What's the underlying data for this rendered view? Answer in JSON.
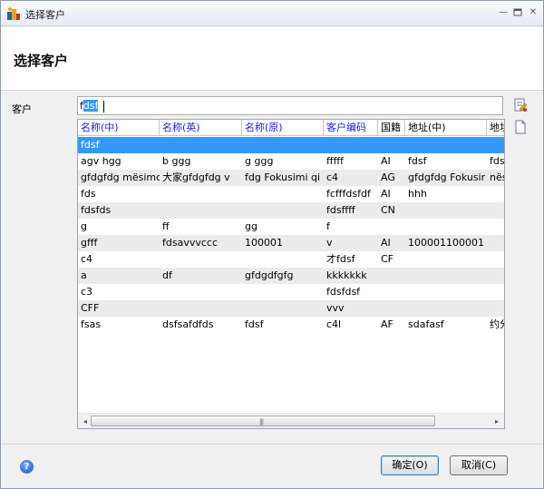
{
  "window": {
    "title": "选择客户",
    "minimize_glyph": "—",
    "restore_glyph": "▫",
    "close_glyph": "✕"
  },
  "header": {
    "title": "选择客户"
  },
  "form": {
    "customer_label": "客户",
    "search_prefix": "f",
    "search_selected": "dsf"
  },
  "grid": {
    "columns": [
      "名称(中)",
      "名称(英)",
      "名称(原)",
      "客户编码",
      "国籍",
      "地址(中)",
      "地址"
    ],
    "rows": [
      [
        "fdsf",
        "",
        "",
        "",
        "",
        "",
        ""
      ],
      [
        "agv  hgg",
        "b ggg",
        "g  ggg",
        "fffff",
        "AI",
        "fdsf",
        "fds"
      ],
      [
        "gfdgfdg mësimo",
        "大家gfdgfdg v",
        "fdg Fokusimi qi",
        "c4",
        "AG",
        "gfdgfdg Fokusir",
        "nës"
      ],
      [
        "fds",
        "",
        "",
        "fcfffdsfdf",
        "AI",
        "hhh",
        ""
      ],
      [
        "fdsfds",
        "",
        "",
        "fdsffff",
        "CN",
        "",
        ""
      ],
      [
        "g",
        "ff",
        "gg",
        "f",
        "",
        "",
        ""
      ],
      [
        "gfff",
        "fdsavvvccc",
        "100001",
        "v",
        "AI",
        "100001100001",
        ""
      ],
      [
        "c4",
        "",
        "",
        "才fdsf",
        "CF",
        "",
        ""
      ],
      [
        "a",
        "df",
        "gfdgdfgfg",
        "kkkkkkk",
        "",
        "",
        ""
      ],
      [
        "c3",
        "",
        "",
        "fdsfdsf",
        "",
        "",
        ""
      ],
      [
        "CFF",
        "",
        "",
        "vvv",
        "",
        "",
        ""
      ],
      [
        "fsas",
        "dsfsafdfds",
        "fdsf",
        "c4l",
        "AF",
        "sdafasf",
        "约分"
      ]
    ],
    "scroll_left_glyph": "◂",
    "scroll_right_glyph": "▸",
    "scroll_grip": "|||"
  },
  "footer": {
    "help_glyph": "?",
    "ok_label": "确定(O)",
    "cancel_label": "取消(C)"
  },
  "colors": {
    "selection": "#3399ff",
    "header_link": "#1a1aff"
  }
}
